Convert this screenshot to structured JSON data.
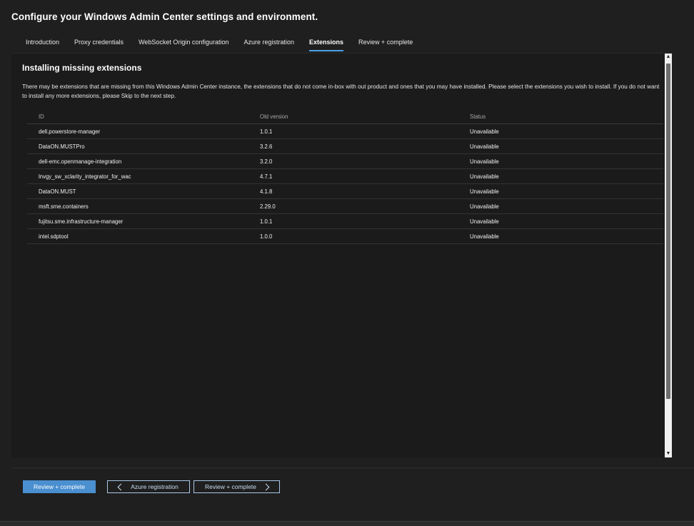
{
  "header": {
    "title": "Configure your Windows Admin Center settings and environment."
  },
  "tabs": [
    {
      "label": "Introduction"
    },
    {
      "label": "Proxy credentials"
    },
    {
      "label": "WebSocket Origin configuration"
    },
    {
      "label": "Azure registration"
    },
    {
      "label": "Extensions"
    },
    {
      "label": "Review + complete"
    }
  ],
  "main": {
    "section_title": "Installing missing extensions",
    "description": "There may be extensions that are missing from this Windows Admin Center instance, the extensions that do not come in-box with out product and ones that you may have installed. Please select the extensions you wish to install. If you do not want to install any more extensions, please Skip to the next step.",
    "table": {
      "headers": {
        "id": "ID",
        "version": "Old version",
        "status": "Status"
      },
      "rows": [
        {
          "id": "dell.powerstore-manager",
          "version": "1.0.1",
          "status": "Unavailable"
        },
        {
          "id": "DataON.MUSTPro",
          "version": "3.2.6",
          "status": "Unavailable"
        },
        {
          "id": "dell-emc.openmanage-integration",
          "version": "3.2.0",
          "status": "Unavailable"
        },
        {
          "id": "lnvgy_sw_xclarity_integrator_for_wac",
          "version": "4.7.1",
          "status": "Unavailable"
        },
        {
          "id": "DataON.MUST",
          "version": "4.1.8",
          "status": "Unavailable"
        },
        {
          "id": "msft.sme.containers",
          "version": "2.29.0",
          "status": "Unavailable"
        },
        {
          "id": "fujitsu.sme.infrastructure-manager",
          "version": "1.0.1",
          "status": "Unavailable"
        },
        {
          "id": "intel.sdptool",
          "version": "1.0.0",
          "status": "Unavailable"
        }
      ]
    }
  },
  "footer": {
    "primary_label": "Review + complete",
    "back_label": "Azure registration",
    "next_label": "Review + complete"
  },
  "colors": {
    "accent": "#4a8fd0",
    "background": "#1f1f1f"
  },
  "icons": {
    "back": "chevron-left-icon",
    "next": "chevron-right-icon",
    "scroll_up": "arrow-up-icon",
    "scroll_down": "arrow-down-icon"
  }
}
